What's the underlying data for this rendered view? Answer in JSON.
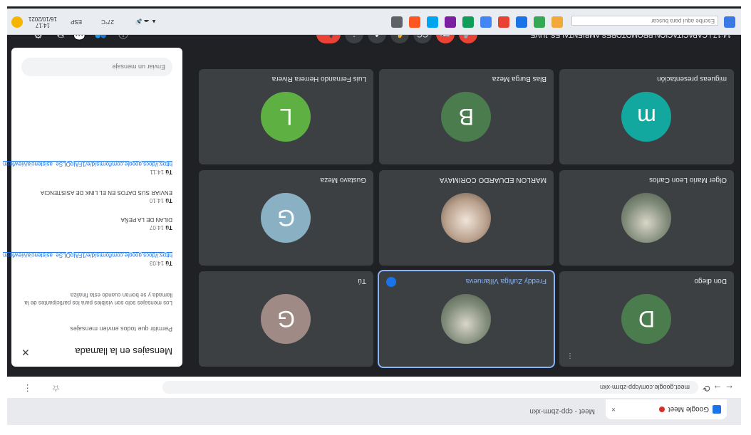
{
  "browser": {
    "tab_title": "Google Meet",
    "tab_close": "×",
    "tab2_title": "Meet - cpp-zbrm-xkn",
    "nav_icons": "← →  ⟳",
    "url": "meet.google.com/cpp-zbrm-xkn",
    "tools": "☆ ⋮"
  },
  "meeting": {
    "time_title": "14:17  |  CAPACITACION PROMOTORES AMBIENTALES JUVE..."
  },
  "controls": {
    "mic": "🎤",
    "cam": "📷",
    "cc": "CC",
    "hand": "✋",
    "present": "⬆",
    "more": "⋮",
    "end": "📞",
    "info": "ⓘ",
    "people": "👥",
    "chat": "💬",
    "activities": "⧉",
    "people_count": "9"
  },
  "participants": [
    {
      "name": "Don diego",
      "initial": "D",
      "color": "#4a7c4e"
    },
    {
      "name": "Freddy Zuñiga Villanueva",
      "initial": "",
      "color": "photo"
    },
    {
      "name": "Tú",
      "initial": "G",
      "color": "#a08a86"
    },
    {
      "name": "Olger Mario Leon Carlos",
      "initial": "",
      "color": "photo"
    },
    {
      "name": "MARLON EDUARDO CORIMAYA",
      "initial": "",
      "color": "photo"
    },
    {
      "name": "Gustavo Meza",
      "initial": "G",
      "color": "#8ab0c4"
    },
    {
      "name": "migueas presentación",
      "initial": "m",
      "color": "#12a8a0"
    },
    {
      "name": "Blas Burga Meza",
      "initial": "B",
      "color": "#4a7c4e"
    },
    {
      "name": "Luis Fernando Herrera Rivera",
      "initial": "L",
      "color": "#5fb043"
    }
  ],
  "chat": {
    "title": "Mensajes en la llamada",
    "close": "✕",
    "toggle_label": "Permitir que todos envíen mensajes",
    "note": "Los mensajes solo son visibles para los participantes de la llamada y se borran cuando esta finaliza",
    "messages": [
      {
        "who": "Tú",
        "time": "14:03",
        "text": "https://docs.google.com/forms/d/e/1FAIpQLSe_asistencia/viewform"
      },
      {
        "who": "Tú",
        "time": "14:07",
        "text": "DILAN DE LA PEÑA"
      },
      {
        "who": "Tú",
        "time": "14:10",
        "text": "ENVIAR SUS DATOS EN EL LINK DE ASISTENCIA"
      },
      {
        "who": "Tú",
        "time": "14:11",
        "text": "https://docs.google.com/forms/d/e/1FAIpQLSe_asistencia/viewform"
      }
    ],
    "input_placeholder": "Enviar un mensaje"
  },
  "taskbar": {
    "time": "14:17",
    "date": "16/10/2021",
    "lang": "ESP",
    "weather": "27°C",
    "search": "Escribe aquí para buscar",
    "tray_icons": "▲ ☁ 🔊"
  }
}
